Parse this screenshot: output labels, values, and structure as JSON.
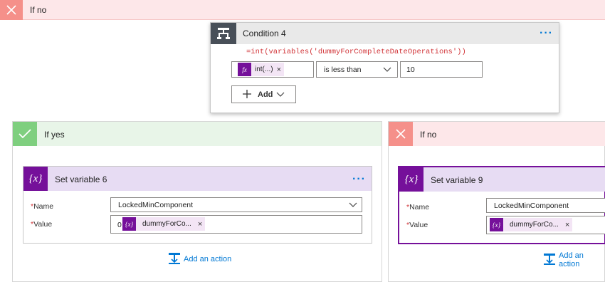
{
  "top_branch": {
    "label": "If no"
  },
  "condition": {
    "title": "Condition 4",
    "expression": "=int(variables('dummyForCompleteDateOperations'))",
    "left_token": {
      "icon": "fx",
      "label": "int(...)",
      "remove": "×"
    },
    "operator": "is less than",
    "right_value": "10",
    "add_label": "Add",
    "menu": "···"
  },
  "if_yes": {
    "label": "If yes",
    "card": {
      "title": "Set variable 6",
      "menu": "···",
      "name_label": "Name",
      "name_value": "LockedMinComponent",
      "value_label": "Value",
      "value_prefix": "0",
      "value_token": "dummyForCo...",
      "remove": "×",
      "icon_text": "{x}"
    },
    "add_action": "Add an action"
  },
  "if_no": {
    "label": "If no",
    "card": {
      "title": "Set variable 9",
      "name_label": "Name",
      "name_value": "LockedMinComponent",
      "value_label": "Value",
      "value_token": "dummyForCo...",
      "remove": "×",
      "icon_text": "{x}"
    },
    "add_action": "Add an action"
  },
  "required_marker": "*",
  "colors": {
    "accent_blue": "#0078d4",
    "variable_purple": "#75109a",
    "yes_green": "#7fcf7f",
    "no_red": "#f5908a",
    "expression_red": "#d13438"
  }
}
